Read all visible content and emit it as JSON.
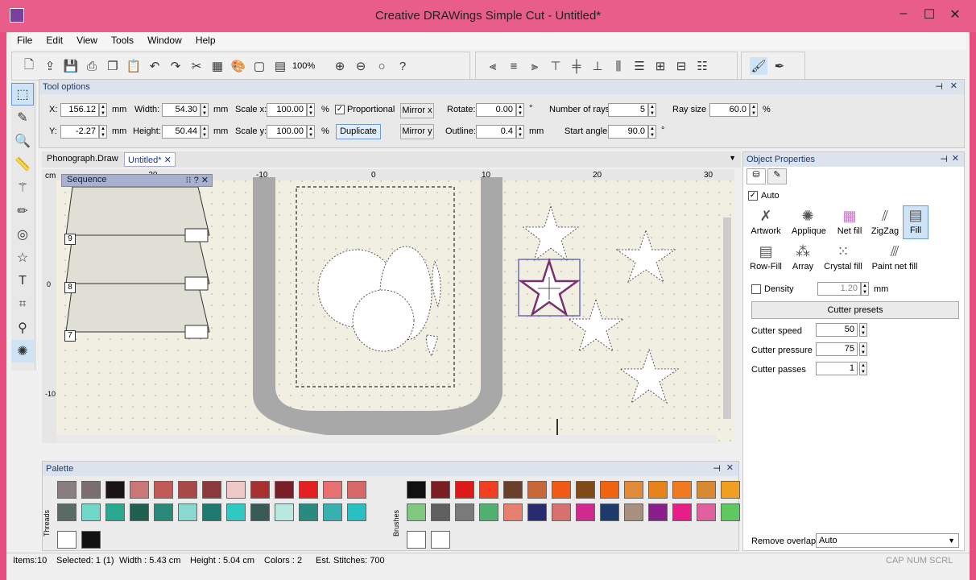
{
  "window": {
    "title": "Creative DRAWings Simple Cut - Untitled*"
  },
  "menu": [
    "File",
    "Edit",
    "View",
    "Tools",
    "Window",
    "Help"
  ],
  "toolbar": {
    "zoom": "100%"
  },
  "tool_options": {
    "title": "Tool options",
    "x_label": "X:",
    "x": "156.12",
    "x_unit": "mm",
    "y_label": "Y:",
    "y": "-2.27",
    "y_unit": "mm",
    "width_label": "Width:",
    "width": "54.30",
    "width_unit": "mm",
    "height_label": "Height:",
    "height": "50.44",
    "height_unit": "mm",
    "scalex_label": "Scale x:",
    "scalex": "100.00",
    "scalex_unit": "%",
    "scaley_label": "Scale y:",
    "scaley": "100.00",
    "scaley_unit": "%",
    "proportional": "Proportional",
    "duplicate": "Duplicate",
    "mirror_x": "Mirror x",
    "mirror_y": "Mirror y",
    "rotate_label": "Rotate:",
    "rotate": "0.00",
    "rotate_unit": "°",
    "outline_label": "Outline:",
    "outline": "0.4",
    "outline_unit": "mm",
    "rays_label": "Number of rays:",
    "rays": "5",
    "start_angle_label": "Start angle:",
    "start_angle": "90.0",
    "start_angle_unit": "°",
    "ray_size_label": "Ray size :",
    "ray_size": "60.0",
    "ray_size_unit": "%"
  },
  "doc_tabs": [
    "Phonograph.Draw",
    "Untitled*"
  ],
  "canvas": {
    "ruler_unit": "cm",
    "h_ticks": [
      "-20",
      "-10",
      "0",
      "10",
      "20",
      "30"
    ],
    "v_ticks": [
      "0",
      "-10"
    ],
    "sequence_title": "Sequence",
    "sequence_items": [
      "9",
      "8",
      "7"
    ]
  },
  "palette": {
    "title": "Palette",
    "threads_label": "Threads",
    "brushes_label": "Brushes",
    "thread_colors_row1": [
      "#8a7f7f",
      "#7a6e6e",
      "#1a1414",
      "#c87878",
      "#c25a5a",
      "#a84848",
      "#8a3a3a",
      "#f0c8c8",
      "#a83030",
      "#7a1e2a",
      "#e62020",
      "#e87070",
      "#d86868"
    ],
    "thread_colors_row2": [
      "#5a6a64",
      "#70d8c8",
      "#2aa890",
      "#206050",
      "#2a8a7a",
      "#8ad8d0",
      "#1e7a70",
      "#30c8c0",
      "#3a5a58",
      "#b8e8e0",
      "#2a8a80",
      "#38b0b0",
      "#28c0c0"
    ],
    "brush_colors_row1": [
      "#101010",
      "#7a1e24",
      "#e01818",
      "#f04020",
      "#6a4028",
      "#c86838",
      "#f05a14",
      "#804a18",
      "#f06410",
      "#e08a3a",
      "#e8821a",
      "#f07a20",
      "#d88a30",
      "#f0a020"
    ],
    "brush_colors_row2": [
      "#80c880",
      "#606060",
      "#7a7a7a",
      "#50b070",
      "#e88070",
      "#2a2a70",
      "#d87070",
      "#d02a90",
      "#1e3a6a",
      "#a89080",
      "#8a1e8a",
      "#e81e88",
      "#e060a0",
      "#60c860"
    ]
  },
  "object_properties": {
    "title": "Object Properties",
    "auto": "Auto",
    "types": [
      "Artwork",
      "Applique",
      "Net fill",
      "ZigZag",
      "Fill",
      "Row-Fill",
      "Array",
      "Crystal fill",
      "Paint net fill"
    ],
    "density_label": "Density",
    "density": "1.20",
    "density_unit": "mm",
    "cutter_presets": "Cutter presets",
    "cutter_speed_label": "Cutter speed",
    "cutter_speed": "50",
    "cutter_pressure_label": "Cutter pressure",
    "cutter_pressure": "75",
    "cutter_passes_label": "Cutter passes",
    "cutter_passes": "1",
    "remove_overlaps_label": "Remove overlaps",
    "remove_overlaps": "Auto"
  },
  "status": {
    "items": "Items:10",
    "selected": "Selected: 1 (1)",
    "width": "Width : 5.43 cm",
    "height": "Height : 5.04 cm",
    "colors": "Colors : 2",
    "stitches": "Est. Stitches: 700",
    "cap": "CAP",
    "num": "NUM",
    "scrl": "SCRL"
  }
}
